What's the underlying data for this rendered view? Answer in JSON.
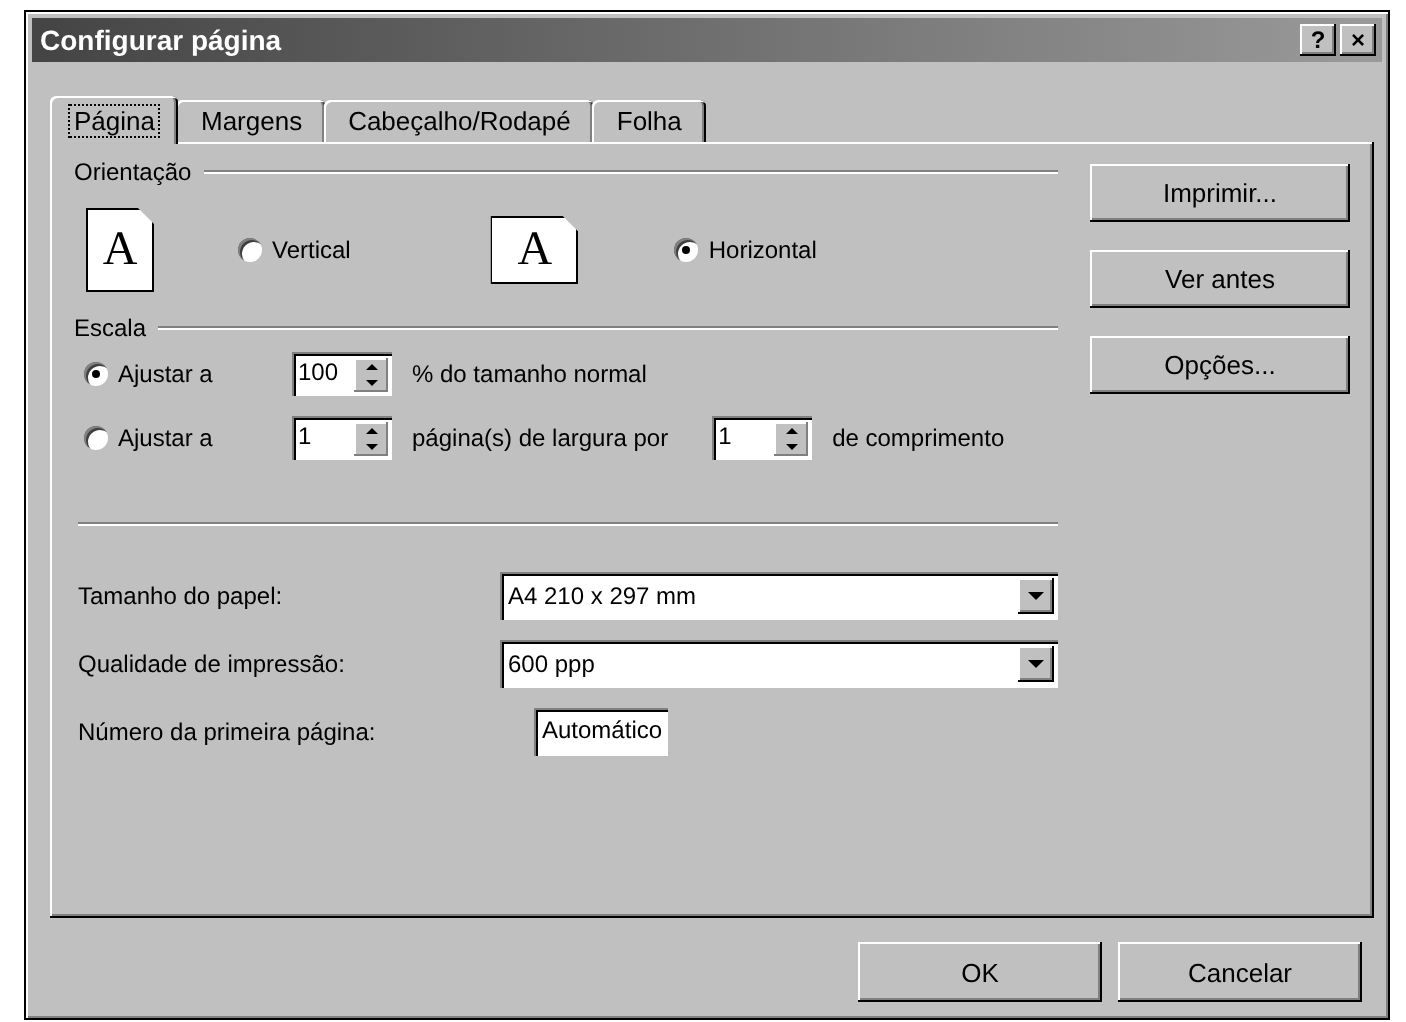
{
  "window": {
    "title": "Configurar página",
    "title_buttons": [
      "?",
      "×"
    ]
  },
  "tabs": [
    {
      "label": "Página",
      "selected": true
    },
    {
      "label": "Margens",
      "selected": false
    },
    {
      "label": "Cabeçalho/Rodapé",
      "selected": false
    },
    {
      "label": "Folha",
      "selected": false
    }
  ],
  "orientation": {
    "label": "Orientação",
    "options": [
      {
        "label": "Vertical",
        "selected": false,
        "kind": "portrait",
        "icon_letter": "A"
      },
      {
        "label": "Horizontal",
        "selected": true,
        "kind": "landscape",
        "icon_letter": "A"
      }
    ]
  },
  "scale": {
    "label": "Escala",
    "rows": [
      {
        "label": "Ajustar a",
        "selected": true,
        "fields": [
          {
            "value": "100",
            "suffix": "% do tamanho normal"
          }
        ]
      },
      {
        "label": "Ajustar a",
        "selected": false,
        "fields": [
          {
            "value": "1",
            "suffix": "página(s) de largura por"
          },
          {
            "value": "1",
            "suffix": "de comprimento"
          }
        ]
      }
    ]
  },
  "form": [
    {
      "label": "Tamanho do papel:",
      "value": "A4 210 x 297 mm",
      "kind": "dropdown"
    },
    {
      "label": "Qualidade de impressão:",
      "value": "600 ppp",
      "kind": "dropdown"
    },
    {
      "label": "Número da primeira página:",
      "value": "Automático",
      "kind": "text"
    }
  ],
  "side_buttons": [
    "Imprimir...",
    "Ver antes",
    "Opções..."
  ],
  "footer_buttons": [
    "OK",
    "Cancelar"
  ]
}
